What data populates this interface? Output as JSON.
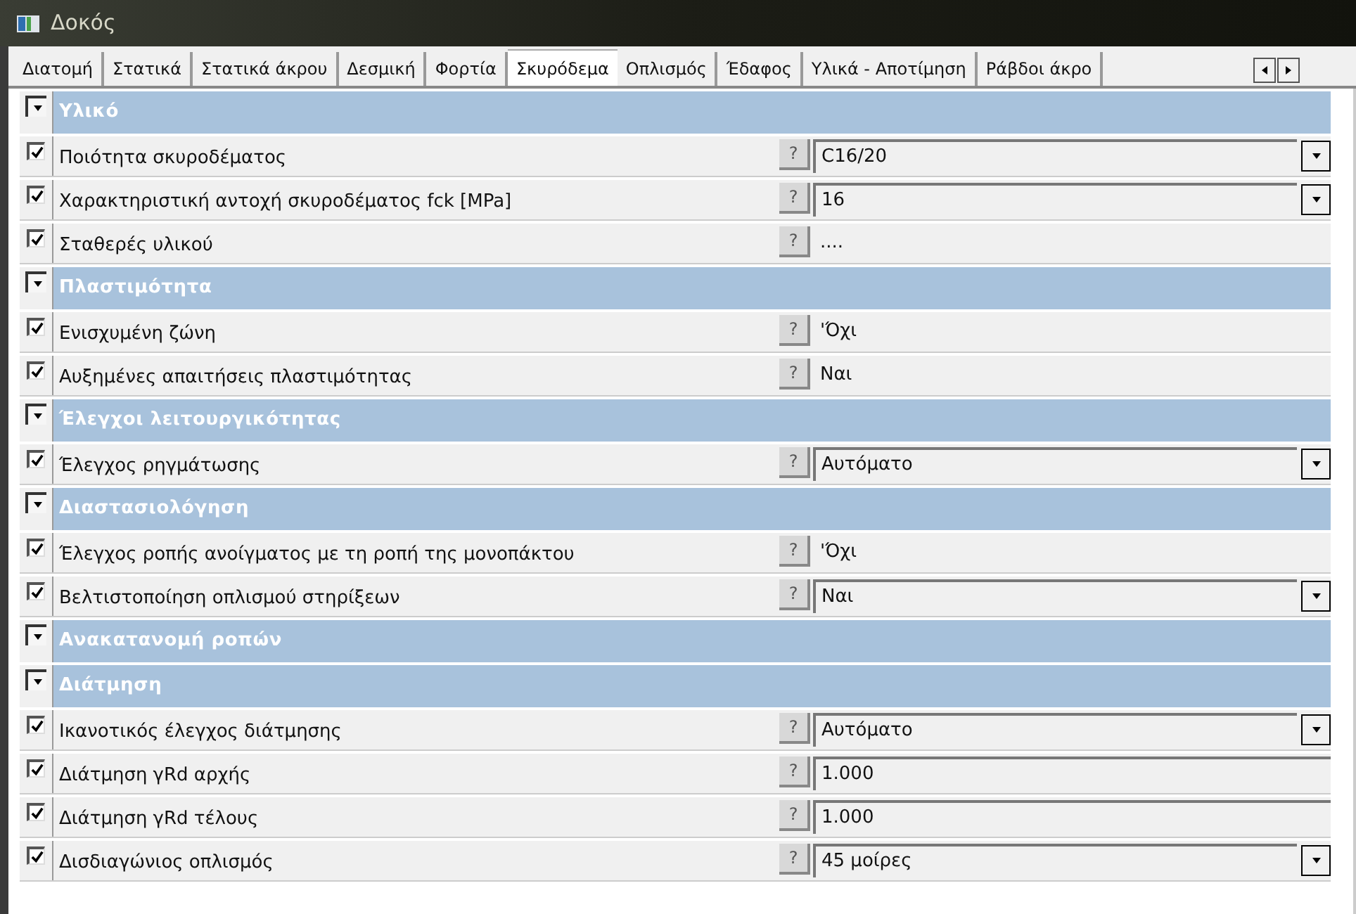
{
  "window": {
    "title": "Δοκός"
  },
  "tabs": [
    {
      "label": "Διατομή",
      "selected": false
    },
    {
      "label": "Στατικά",
      "selected": false
    },
    {
      "label": "Στατικά άκρου",
      "selected": false
    },
    {
      "label": "Δεσμική",
      "selected": false
    },
    {
      "label": "Φορτία",
      "selected": false
    },
    {
      "label": "Σκυρόδεμα",
      "selected": true
    },
    {
      "label": "Οπλισμός",
      "selected": false
    },
    {
      "label": "Έδαφος",
      "selected": false
    },
    {
      "label": "Υλικά - Αποτίμηση",
      "selected": false
    },
    {
      "label": "Ράβδοι άκρο",
      "selected": false
    }
  ],
  "sections": [
    {
      "title": "Υλικό",
      "items": [
        {
          "label": "Ποιότητα σκυροδέματος",
          "checked": true,
          "kind": "dropdown",
          "value": "C16/20"
        },
        {
          "label": "Χαρακτηριστική αντοχή σκυροδέματος fck [MPa]",
          "checked": true,
          "kind": "dropdown",
          "value": "16"
        },
        {
          "label": "Σταθερές υλικού",
          "checked": true,
          "kind": "text",
          "value": "...."
        }
      ]
    },
    {
      "title": "Πλαστιμότητα",
      "items": [
        {
          "label": "Ενισχυμένη ζώνη",
          "checked": true,
          "kind": "text",
          "value": "'Όχι"
        },
        {
          "label": "Αυξημένες απαιτήσεις πλαστιμότητας",
          "checked": true,
          "kind": "text",
          "value": "Ναι"
        }
      ]
    },
    {
      "title": "Έλεγχοι λειτουργικότητας",
      "items": [
        {
          "label": "Έλεγχος ρηγμάτωσης",
          "checked": true,
          "kind": "dropdown",
          "value": "Αυτόματο"
        }
      ]
    },
    {
      "title": "Διαστασιολόγηση",
      "items": [
        {
          "label": "Έλεγχος ροπής ανοίγματος με τη ροπή της μονοπάκτου",
          "checked": true,
          "kind": "text",
          "value": "'Όχι"
        },
        {
          "label": "Βελτιστοποίηση οπλισμού στηρίξεων",
          "checked": true,
          "kind": "dropdown",
          "value": "Ναι"
        }
      ]
    },
    {
      "title": "Ανακατανομή ροπών"
    },
    {
      "title": "Διάτμηση",
      "items": [
        {
          "label": "Ικανοτικός έλεγχος διάτμησης",
          "checked": true,
          "kind": "dropdown",
          "value": "Αυτόματο"
        },
        {
          "label": "Διάτμηση γRd αρχής",
          "checked": true,
          "kind": "edit",
          "value": "1.000"
        },
        {
          "label": "Διάτμηση γRd τέλους",
          "checked": true,
          "kind": "edit",
          "value": "1.000"
        },
        {
          "label": "Δισδιαγώνιος οπλισμός",
          "checked": true,
          "kind": "dropdown",
          "value": "45 μοίρες"
        }
      ]
    }
  ],
  "help_label": "?"
}
